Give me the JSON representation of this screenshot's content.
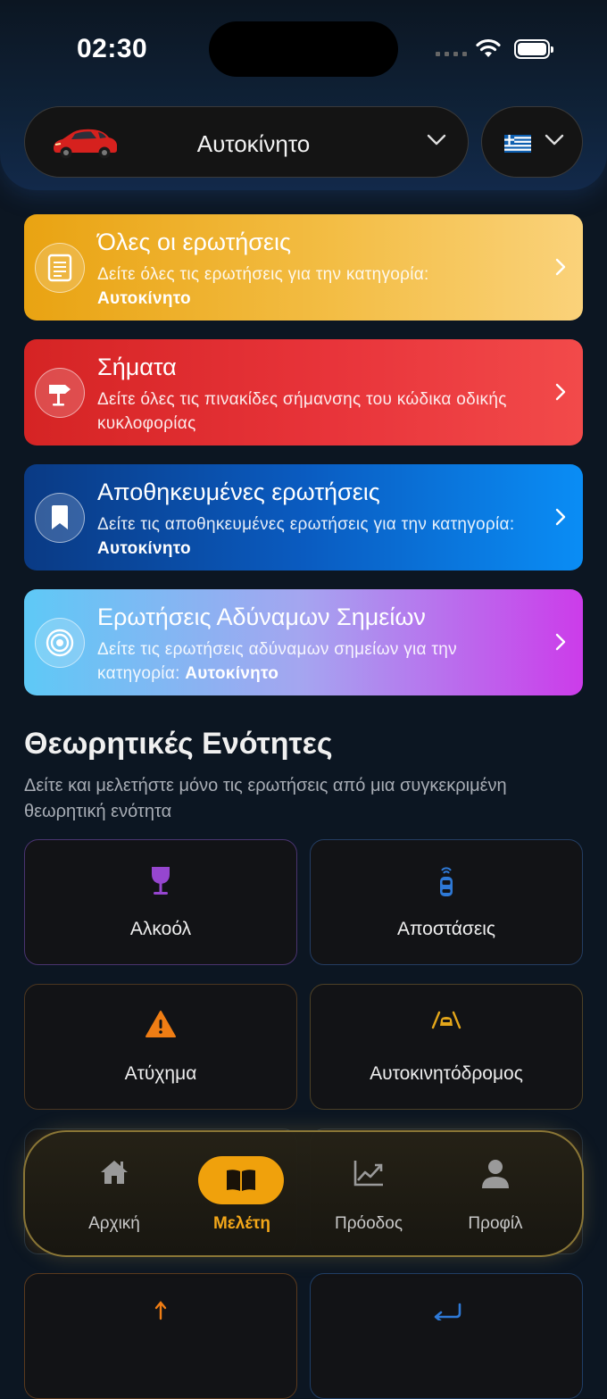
{
  "status": {
    "time": "02:30"
  },
  "header": {
    "category_label": "Αυτοκίνητο",
    "vehicle_icon": "red-car-icon",
    "language_flag": "greece-flag-icon"
  },
  "cards": [
    {
      "title": "Όλες οι ερωτήσεις",
      "desc": "Δείτε όλες τις ερωτήσεις για την κατηγορία: ",
      "desc_bold": "Αυτοκίνητο",
      "icon": "document-list-icon",
      "color": "#f0b030"
    },
    {
      "title": "Σήματα",
      "desc": "Δείτε όλες τις πινακίδες σήμανσης του κώδικα οδικής κυκλοφορίας",
      "desc_bold": "",
      "icon": "signpost-icon",
      "color": "#e0302e"
    },
    {
      "title": "Αποθηκευμένες ερωτήσεις",
      "desc": "Δείτε τις αποθηκευμένες ερωτήσεις για την κατηγορία: ",
      "desc_bold": "Αυτοκίνητο",
      "icon": "bookmark-icon",
      "color": "#0a6fd8"
    },
    {
      "title": "Ερωτήσεις Αδύναμων Σημείων",
      "desc": "Δείτε τις ερωτήσεις αδύναμων σημείων για την κατηγορία: ",
      "desc_bold": "Αυτοκίνητο",
      "icon": "target-icon",
      "color": "#b46cf0"
    }
  ],
  "section": {
    "title": "Θεωρητικές Ενότητες",
    "subtitle": "Δείτε και μελετήστε μόνο τις ερωτήσεις από μια συγκεκριμένη θεωρητική ενότητα"
  },
  "topics": [
    {
      "label": "Αλκοόλ",
      "icon": "wine-glass-icon"
    },
    {
      "label": "Αποστάσεις",
      "icon": "car-sensor-icon"
    },
    {
      "label": "Ατύχημα",
      "icon": "warning-triangle-icon"
    },
    {
      "label": "Αυτοκινητόδρομος",
      "icon": "car-on-road-icon"
    }
  ],
  "tabbar": {
    "home": "Αρχική",
    "study": "Μελέτη",
    "progress": "Πρόοδος",
    "profile": "Προφίλ",
    "active": "study"
  }
}
